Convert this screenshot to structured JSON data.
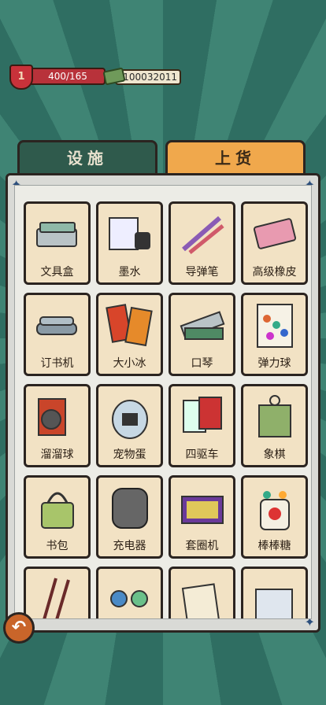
{
  "hud": {
    "level": "1",
    "progress_text": "400/165",
    "money": "100032011"
  },
  "tabs": [
    {
      "label": "设施",
      "active": false
    },
    {
      "label": "上货",
      "active": true
    }
  ],
  "items": [
    {
      "label": "文具盒",
      "icon": "pencil-case-icon"
    },
    {
      "label": "墨水",
      "icon": "ink-bottle-icon"
    },
    {
      "label": "导弹笔",
      "icon": "missile-pen-icon"
    },
    {
      "label": "高级橡皮",
      "icon": "eraser-icon"
    },
    {
      "label": "订书机",
      "icon": "stapler-icon"
    },
    {
      "label": "大小冰",
      "icon": "ice-pop-icon"
    },
    {
      "label": "口琴",
      "icon": "harmonica-icon"
    },
    {
      "label": "弹力球",
      "icon": "bouncy-ball-icon"
    },
    {
      "label": "溜溜球",
      "icon": "yoyo-icon"
    },
    {
      "label": "宠物蛋",
      "icon": "pet-egg-icon"
    },
    {
      "label": "四驱车",
      "icon": "toy-car-icon"
    },
    {
      "label": "象棋",
      "icon": "chess-icon"
    },
    {
      "label": "书包",
      "icon": "schoolbag-icon"
    },
    {
      "label": "充电器",
      "icon": "charger-icon"
    },
    {
      "label": "套圈机",
      "icon": "ring-toss-icon"
    },
    {
      "label": "棒棒糖",
      "icon": "lollipop-icon"
    },
    {
      "label": "",
      "icon": "chopsticks-icon"
    },
    {
      "label": "",
      "icon": "figurines-icon"
    },
    {
      "label": "",
      "icon": "paper-icon"
    },
    {
      "label": "",
      "icon": "boxes-icon"
    }
  ],
  "colors": {
    "accent": "#f0a84c",
    "card": "#f2e2c4",
    "background": "#2f6e62"
  }
}
